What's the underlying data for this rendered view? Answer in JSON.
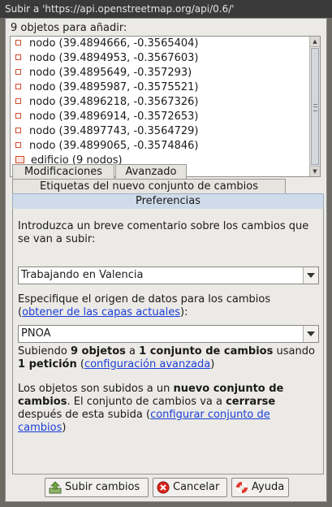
{
  "window": {
    "title": "Subir a 'https://api.openstreetmap.org/api/0.6/'"
  },
  "objects": {
    "header": "9 objetos para añadir:",
    "items": [
      {
        "label": "nodo (39.4894666, -0.3565404)",
        "icon": "node-icon"
      },
      {
        "label": "nodo (39.4894953, -0.3567603)",
        "icon": "node-icon"
      },
      {
        "label": "nodo (39.4895649, -0.357293)",
        "icon": "node-icon"
      },
      {
        "label": "nodo (39.4895987, -0.3575521)",
        "icon": "node-icon"
      },
      {
        "label": "nodo (39.4896218, -0.3567326)",
        "icon": "node-icon"
      },
      {
        "label": "nodo (39.4896914, -0.3572653)",
        "icon": "node-icon"
      },
      {
        "label": "nodo (39.4897743, -0.3564729)",
        "icon": "node-icon"
      },
      {
        "label": "nodo (39.4899065, -0.3574846)",
        "icon": "node-icon"
      },
      {
        "label": "edificio (9 nodos)",
        "icon": "building-icon"
      }
    ]
  },
  "tabs": {
    "modifications": "Modificaciones",
    "advanced": "Avanzado",
    "tags": "Etiquetas del nuevo conjunto de cambios",
    "preferences": "Preferencias"
  },
  "preferences": {
    "comment_label": "Introduzca un breve comentario sobre los cambios que se van a subir:",
    "comment_value": "Trabajando en Valencia",
    "source_label": "Especifique el origen de datos para los cambios",
    "source_link": "obtener de las capas actuales",
    "source_suffix": "):",
    "source_value": "PNOA",
    "upload_info": {
      "p1": "Subiendo ",
      "objects": "9 objetos",
      "p2": " a ",
      "changesets": "1 conjunto de cambios",
      "p3": " usando ",
      "requests": "1 petición",
      "p4": " (",
      "link": "configuración avanzada",
      "p5": ")"
    },
    "changeset_info": {
      "p1": "Los objetos son subidos a un ",
      "new_changeset": "nuevo conjunto de cambios",
      "p2": ". El conjunto de cambios va a ",
      "close": "cerrarse",
      "p3": " después de esta subida (",
      "link": "configurar conjunto de cambios",
      "p4": ")"
    }
  },
  "buttons": {
    "upload": "Subir cambios",
    "cancel": "Cancelar",
    "help": "Ayuda"
  },
  "colors": {
    "accent_tab": "#cfdbe9",
    "link": "#1a3ed6",
    "node_icon": "#d04a2a"
  }
}
